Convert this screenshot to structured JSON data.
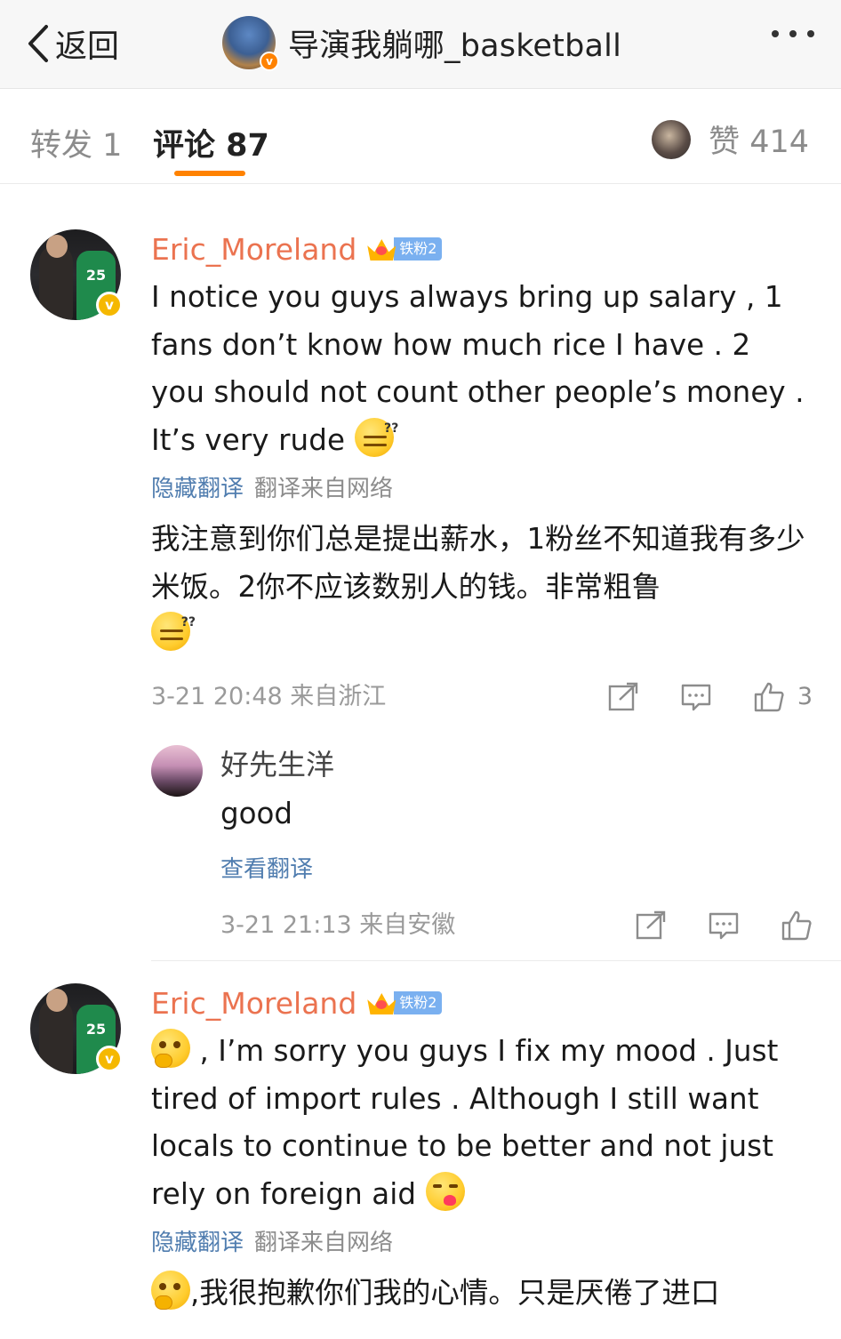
{
  "header": {
    "back_label": "返回",
    "title": "导演我躺哪_basketball"
  },
  "tabs": {
    "repost": "转发 1",
    "comments": "评论 87",
    "likes": "赞 414"
  },
  "comments": [
    {
      "username": "Eric_Moreland",
      "fan_badge": "铁粉2",
      "text_en": "I notice you guys always bring up salary , 1 fans don’t know how much rice I have . 2 you should not count other people’s money . It’s very rude",
      "translate_link": "隐藏翻译",
      "translate_source": "翻译来自网络",
      "text_zh": "我注意到你们总是提出薪水，1粉丝不知道我有多少米饭。2你不应该数别人的钱。非常粗鲁",
      "meta": "3-21 20:48  来自浙江",
      "like_count": "3",
      "emoji": "dizzy-face-emoji"
    },
    {
      "username": "Eric_Moreland",
      "fan_badge": "铁粉2",
      "text_en": ", I’m sorry you guys I fix my mood . Just tired of import rules . Although I still want locals to continue to be better and not just rely on foreign aid",
      "translate_link": "隐藏翻译",
      "translate_source": "翻译来自网络",
      "text_zh": ",我很抱歉你们我的心情。只是厌倦了进口",
      "emoji_start": "thinking-face-emoji",
      "emoji_end": "kiss-face-emoji"
    }
  ],
  "reply": {
    "username": "好先生洋",
    "text": "good",
    "translate_link": "查看翻译",
    "meta": "3-21 21:13  来自安徽"
  },
  "colors": {
    "accent": "#ff8200",
    "username": "#eb7350",
    "link": "#507daf",
    "muted": "#9a9a9a"
  }
}
